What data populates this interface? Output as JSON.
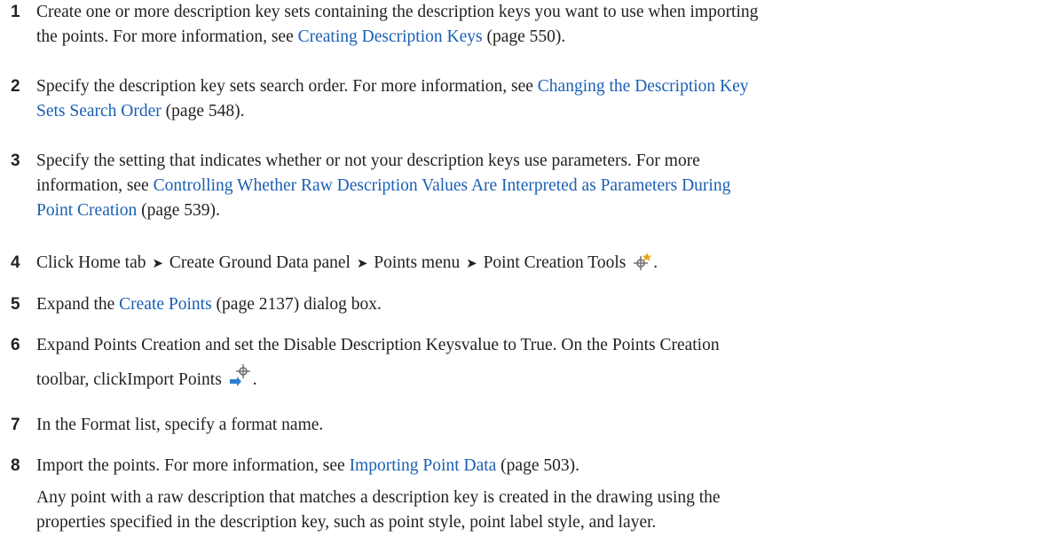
{
  "steps": [
    {
      "number": "1",
      "l1": "Create one or more description key sets containing the description keys you want to use when importing",
      "l2_pre": "the points. For more information, see ",
      "link": "Creating Description Keys",
      "ref": " (page 550)."
    },
    {
      "number": "2",
      "l1_pre": "Specify the description key sets search order. For more information, see ",
      "link_a": "Changing the Description Key",
      "link_b": "Sets Search Order",
      "ref": " (page 548)."
    },
    {
      "number": "3",
      "l1": "Specify the setting that indicates whether or not your description keys use parameters. For more",
      "l2_pre": "information, see ",
      "link_a": "Controlling Whether Raw Description Values Are Interpreted as Parameters During",
      "link_b": "Point Creation",
      "ref": " (page 539)."
    },
    {
      "number": "4",
      "parts": [
        "Click Home tab",
        "Create Ground Data panel",
        "Points menu",
        "Point Creation Tools"
      ],
      "separator": "➤",
      "icon": "point-creation-tools-icon",
      "end": "."
    },
    {
      "number": "5",
      "pre": "Expand the ",
      "link": "Create Points",
      "ref": " (page 2137)",
      "post": " dialog box."
    },
    {
      "number": "6",
      "l1": "Expand Points Creation and set the Disable Description Keysvalue to True. On the Points Creation",
      "l2": "toolbar, clickImport Points",
      "icon": "import-points-icon",
      "end": "."
    },
    {
      "number": "7",
      "text": "In the Format list, specify a format name."
    },
    {
      "number": "8",
      "pre": "Import the points. For more information, see ",
      "link": "Importing Point Data",
      "ref": " (page 503).",
      "note_l1": "Any point with a raw description that matches a description key is created in the drawing using the",
      "note_l2": "properties specified in the description key, such as point style, point label style, and layer."
    }
  ],
  "colors": {
    "text": "#222222",
    "link": "#1a5fb4",
    "icon_orange": "#e8a317",
    "icon_blue": "#2d7fd3",
    "icon_gray": "#6b6b6b"
  }
}
